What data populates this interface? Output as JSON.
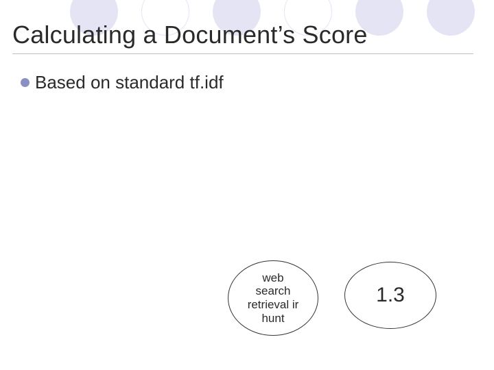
{
  "title": "Calculating a Document’s Score",
  "bullet": "Based on standard tf.idf",
  "ellipse_left_text": "web\nsearch\nretrieval ir\nhunt",
  "ellipse_right_text": "1.3",
  "colors": {
    "deco_fill": "#e4e4f4",
    "bullet_dot": "#8b90c4",
    "underline": "#c0c0c0"
  }
}
